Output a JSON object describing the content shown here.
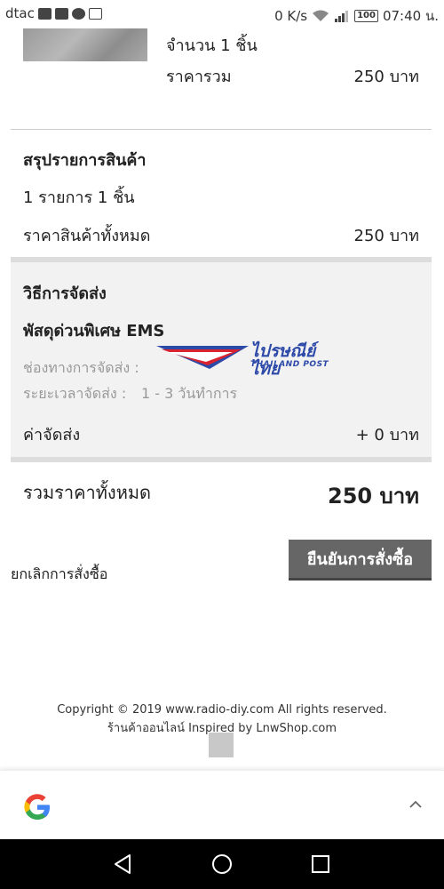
{
  "status_bar": {
    "carrier": "dtac",
    "speed": "0 K/s",
    "battery": "100",
    "time": "07:40 น."
  },
  "product": {
    "quantity_label": "จำนวน 1 ชิ้น",
    "total_label": "ราคารวม",
    "total_value": "250 บาท"
  },
  "summary": {
    "heading": "สรุปรายการสินค้า",
    "items_line": "1 รายการ 1 ชิ้น",
    "all_price_label": "ราคาสินค้าทั้งหมด",
    "all_price_value": "250 บาท"
  },
  "shipping": {
    "heading": "วิธีการจัดส่ง",
    "method": "พัสดุด่วนพิเศษ EMS",
    "channel_label": "ช่องทางการจัดส่ง :",
    "duration_label": "ระยะเวลาจัดส่ง :",
    "duration_value": "1 - 3 วันทำการ",
    "fee_label": "ค่าจัดส่ง",
    "fee_value": "+ 0 บาท",
    "logo_text_main": "ไปรษณีย์ไทย",
    "logo_text_sub": "THAILAND POST"
  },
  "grand_total": {
    "label": "รวมราคาทั้งหมด",
    "value": "250 บาท"
  },
  "actions": {
    "cancel": "ยกเลิกการสั่งซื้อ",
    "confirm": "ยืนยันการสั่งซื้อ"
  },
  "footer": {
    "copyright": "Copyright © 2019 www.radio-diy.com All rights reserved.",
    "credit": "ร้านค้าออนไลน์  Inspired by  LnwShop.com"
  },
  "colors": {
    "confirm_button": "#666666",
    "divider": "#dddddd",
    "section_bg": "#f2f2f2"
  }
}
